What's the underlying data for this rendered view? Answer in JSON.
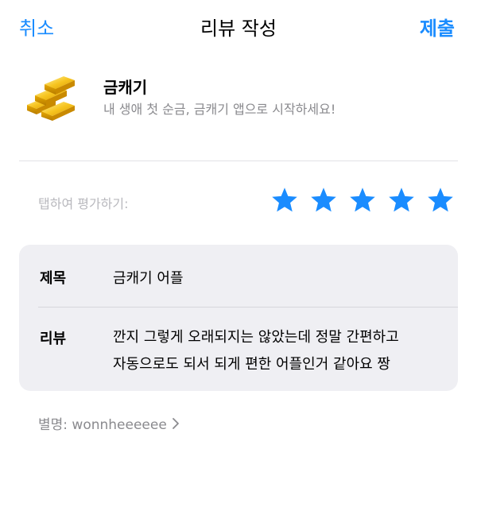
{
  "nav": {
    "cancel_label": "취소",
    "title": "리뷰 작성",
    "submit_label": "제출"
  },
  "app": {
    "name": "금캐기",
    "subtitle": "내 생애 첫 순금, 금캐기 앱으로 시작하세요!",
    "icon": "gold-bars-icon"
  },
  "rating": {
    "label": "탭하여 평가하기:",
    "value": 5,
    "max": 5,
    "color": "#1a8cff"
  },
  "form": {
    "title_label": "제목",
    "title_value": "금캐기 어플",
    "review_label": "리뷰",
    "review_lines": [
      "깐지 그렇게 오래되지는 않았는데 정말 간편하고",
      "자동으로도 되서 되게 편한 어플인거 같아요 짱"
    ]
  },
  "nickname": {
    "label": "별명: wonnheeeeee"
  },
  "colors": {
    "accent": "#1a8cff",
    "card_bg": "#efeff3",
    "secondary_text": "#8a8a8e"
  }
}
